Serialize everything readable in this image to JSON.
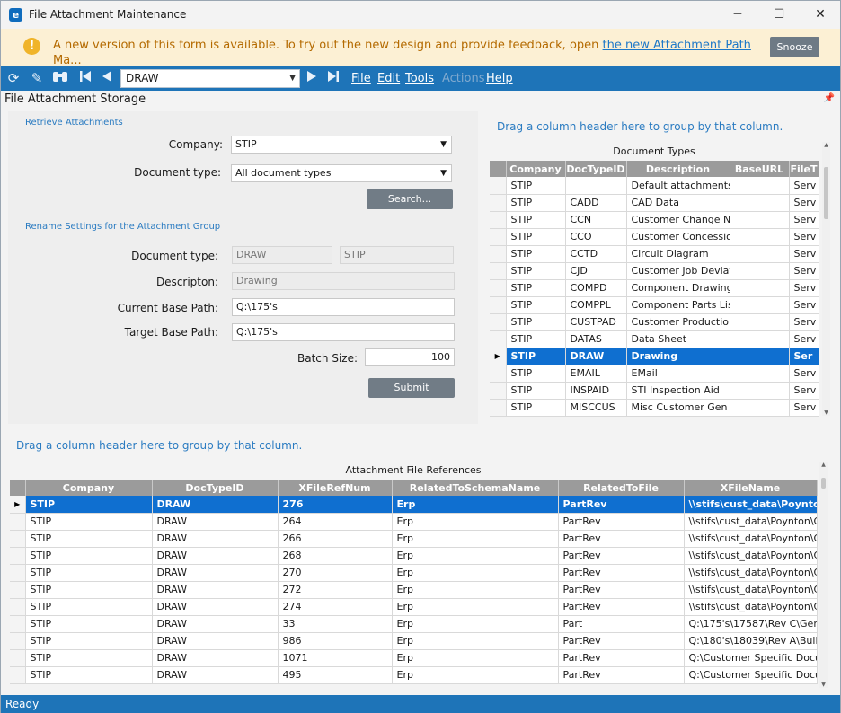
{
  "window": {
    "title": "File Attachment Maintenance",
    "app_icon_letter": "e",
    "minimize": "─",
    "maximize": "☐",
    "close": "✕"
  },
  "banner": {
    "message": "A new version of this form is available. To try out the new design and provide feedback, open",
    "link_text": "the new Attachment Path",
    "overflow_text": "Ma...",
    "snooze_label": "Snooze",
    "icon": "warning-icon"
  },
  "toolbar": {
    "icons": [
      "refresh-icon",
      "clear-icon",
      "search-binoculars-icon",
      "first-record-icon",
      "previous-record-icon",
      "next-record-icon",
      "last-record-icon"
    ],
    "nav_value": "DRAW",
    "menus": [
      {
        "label": "File",
        "enabled": true
      },
      {
        "label": "Edit",
        "enabled": true
      },
      {
        "label": "Tools",
        "enabled": true
      },
      {
        "label": "Actions",
        "enabled": false
      },
      {
        "label": "Help",
        "enabled": true
      }
    ]
  },
  "section": {
    "title": "File Attachment Storage",
    "pin_icon": "pin-icon"
  },
  "retrieve": {
    "group_title": "Retrieve Attachments",
    "company_label": "Company:",
    "company_value": "STIP",
    "doctype_label": "Document type:",
    "doctype_value": "All document types",
    "search_label": "Search..."
  },
  "rename": {
    "group_title": "Rename Settings for the Attachment Group",
    "doctype_label": "Document type:",
    "doctype_value": "DRAW",
    "company_value": "STIP",
    "description_label": "Descripton:",
    "description_value": "Drawing",
    "current_path_label": "Current  Base Path:",
    "current_path_value": "Q:\\175's",
    "target_path_label": "Target  Base Path:",
    "target_path_value": "Q:\\175's",
    "batch_label": "Batch Size:",
    "batch_value": "100",
    "submit_label": "Submit"
  },
  "doc_types": {
    "drag_hint": "Drag a column header here to group by that column.",
    "caption": "Document Types",
    "columns": [
      "Company",
      "DocTypeID",
      "Description",
      "BaseURL",
      "FileT"
    ],
    "selected_index": 10,
    "rows": [
      [
        "STIP",
        "",
        "Default attachments",
        "",
        "Serv"
      ],
      [
        "STIP",
        "CADD",
        "CAD Data",
        "",
        "Serv"
      ],
      [
        "STIP",
        "CCN",
        "Customer Change N",
        "",
        "Serv"
      ],
      [
        "STIP",
        "CCO",
        "Customer Concessio",
        "",
        "Serv"
      ],
      [
        "STIP",
        "CCTD",
        "Circuit Diagram",
        "",
        "Serv"
      ],
      [
        "STIP",
        "CJD",
        "Customer Job Deviat",
        "",
        "Serv"
      ],
      [
        "STIP",
        "COMPD",
        "Component Drawing",
        "",
        "Serv"
      ],
      [
        "STIP",
        "COMPPL",
        "Component Parts Lis",
        "",
        "Serv"
      ],
      [
        "STIP",
        "CUSTPAD",
        "Customer Productio",
        "",
        "Serv"
      ],
      [
        "STIP",
        "DATAS",
        "Data Sheet",
        "",
        "Serv"
      ],
      [
        "STIP",
        "DRAW",
        "Drawing",
        "",
        "Ser"
      ],
      [
        "STIP",
        "EMAIL",
        "EMail",
        "",
        "Serv"
      ],
      [
        "STIP",
        "INSPAID",
        "STI Inspection Aid",
        "",
        "Serv"
      ],
      [
        "STIP",
        "MISCCUS",
        "Misc Customer Gen",
        "",
        "Serv"
      ]
    ]
  },
  "file_refs": {
    "drag_hint": "Drag a column header here to group by that column.",
    "caption": "Attachment File References",
    "columns": [
      "Company",
      "DocTypeID",
      "XFileRefNum",
      "RelatedToSchemaName",
      "RelatedToFile",
      "XFileName"
    ],
    "selected_index": 0,
    "rows": [
      [
        "STIP",
        "DRAW",
        "276",
        "Erp",
        "PartRev",
        "\\\\stifs\\cust_data\\Poynton\\Cu"
      ],
      [
        "STIP",
        "DRAW",
        "264",
        "Erp",
        "PartRev",
        "\\\\stifs\\cust_data\\Poynton\\Cu"
      ],
      [
        "STIP",
        "DRAW",
        "266",
        "Erp",
        "PartRev",
        "\\\\stifs\\cust_data\\Poynton\\Cu"
      ],
      [
        "STIP",
        "DRAW",
        "268",
        "Erp",
        "PartRev",
        "\\\\stifs\\cust_data\\Poynton\\Cu"
      ],
      [
        "STIP",
        "DRAW",
        "270",
        "Erp",
        "PartRev",
        "\\\\stifs\\cust_data\\Poynton\\Cu"
      ],
      [
        "STIP",
        "DRAW",
        "272",
        "Erp",
        "PartRev",
        "\\\\stifs\\cust_data\\Poynton\\Cu"
      ],
      [
        "STIP",
        "DRAW",
        "274",
        "Erp",
        "PartRev",
        "\\\\stifs\\cust_data\\Poynton\\Cu"
      ],
      [
        "STIP",
        "DRAW",
        "33",
        "Erp",
        "Part",
        "Q:\\175's\\17587\\Rev C\\Gerb"
      ],
      [
        "STIP",
        "DRAW",
        "986",
        "Erp",
        "PartRev",
        "Q:\\180's\\18039\\Rev A\\Build"
      ],
      [
        "STIP",
        "DRAW",
        "1071",
        "Erp",
        "PartRev",
        "Q:\\Customer Specific Docu"
      ],
      [
        "STIP",
        "DRAW",
        "495",
        "Erp",
        "PartRev",
        "Q:\\Customer Specific Docu"
      ]
    ]
  },
  "status": {
    "text": "Ready"
  }
}
